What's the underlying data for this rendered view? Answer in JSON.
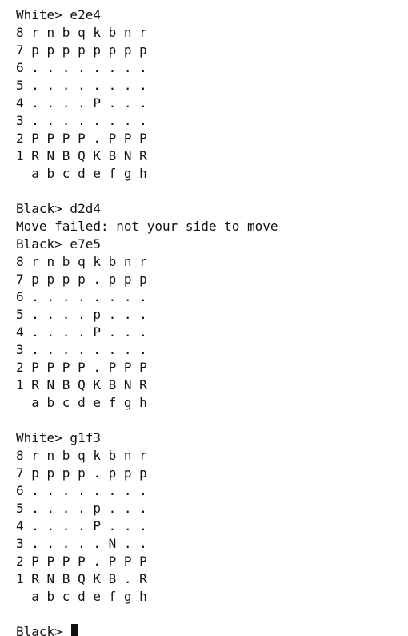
{
  "terminal": {
    "lines": [
      "White> e2e4",
      "8 r n b q k b n r",
      "7 p p p p p p p p",
      "6 . . . . . . . .",
      "5 . . . . . . . .",
      "4 . . . . P . . .",
      "3 . . . . . . . .",
      "2 P P P P . P P P",
      "1 R N B Q K B N R",
      "  a b c d e f g h",
      "",
      "Black> d2d4",
      "Move failed: not your side to move",
      "Black> e7e5",
      "8 r n b q k b n r",
      "7 p p p p . p p p",
      "6 . . . . . . . .",
      "5 . . . . p . . .",
      "4 . . . . P . . .",
      "3 . . . . . . . .",
      "2 P P P P . P P P",
      "1 R N B Q K B N R",
      "  a b c d e f g h",
      "",
      "White> g1f3",
      "8 r n b q k b n r",
      "7 p p p p . p p p",
      "6 . . . . . . . .",
      "5 . . . . p . . .",
      "4 . . . . P . . .",
      "3 . . . . . N . .",
      "2 P P P P . P P P",
      "1 R N B Q K B . R",
      "  a b c d e f g h",
      ""
    ],
    "prompt": "Black> "
  }
}
